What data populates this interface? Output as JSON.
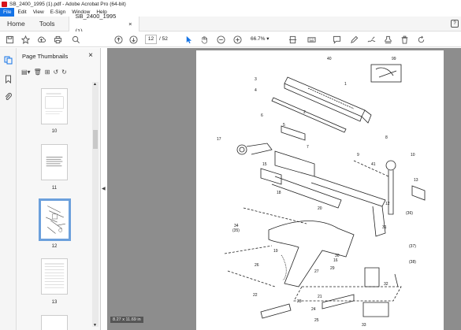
{
  "window": {
    "title": "SB_2400_1995 (1).pdf - Adobe Acrobat Pro (64-bit)"
  },
  "menu": [
    "File",
    "Edit",
    "View",
    "E-Sign",
    "Window",
    "Help"
  ],
  "tabs": {
    "home": "Home",
    "tools": "Tools",
    "doc": "SB_2400_1995 (1)...",
    "doc_close": "×"
  },
  "toolbar": {
    "page_current": "12",
    "page_total": "/ 52",
    "zoom": "66.7%"
  },
  "thumbnails": {
    "title": "Page Thumbnails",
    "close": "×",
    "pages": [
      {
        "label": "10"
      },
      {
        "label": "11"
      },
      {
        "label": "12",
        "selected": true
      },
      {
        "label": "13"
      }
    ]
  },
  "doc": {
    "size_label": "8.27 x 11.69 in"
  },
  "diagram": {
    "part_numbers": [
      "40",
      "99",
      "1",
      "3",
      "4",
      "2",
      "6",
      "5",
      "17",
      "7",
      "15",
      "8",
      "41",
      "10",
      "9",
      "18",
      "20",
      "12",
      "13",
      "34",
      "(35)",
      "(36)",
      "31",
      "(37)",
      "(38)",
      "19",
      "30",
      "26",
      "29",
      "27",
      "16",
      "32",
      "22",
      "23",
      "21",
      "24",
      "25",
      "33"
    ]
  },
  "colors": {
    "accent": "#1473e6",
    "doc_bg": "#8d8d8d",
    "thumb_selected": "#6ca0dc",
    "pdf_red": "#d7141a"
  }
}
